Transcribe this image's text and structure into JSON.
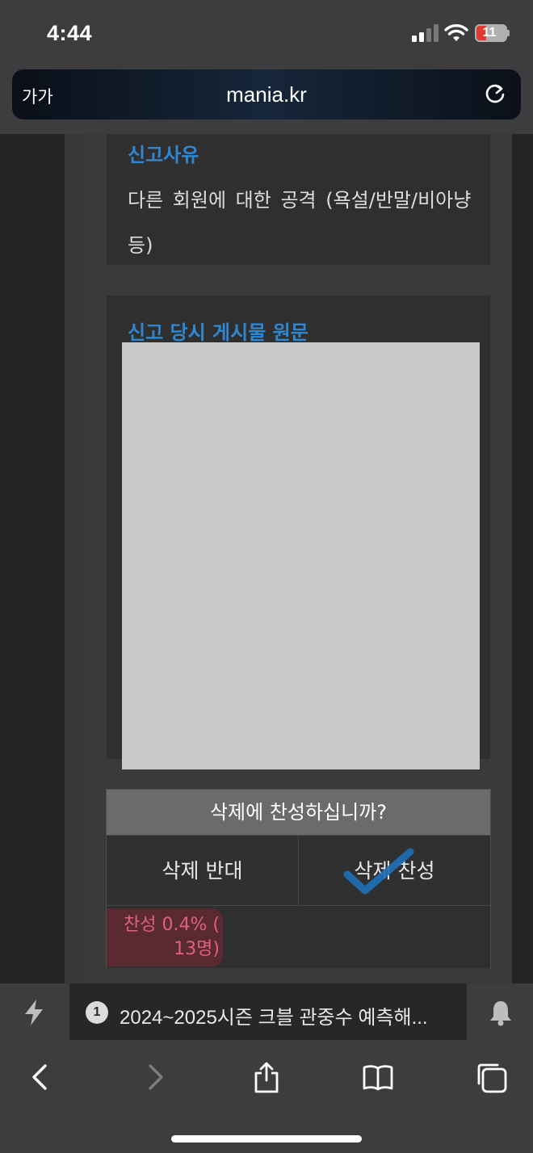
{
  "status_bar": {
    "time": "4:44",
    "battery": "11",
    "icons": [
      "signal-icon",
      "wifi-icon",
      "battery-icon"
    ]
  },
  "address_bar": {
    "text_size_label": "가가",
    "url": "mania.kr",
    "reload_icon": "reload-icon"
  },
  "report": {
    "reason_title": "신고사유",
    "reason_text": "다른 회원에 대한 공격 (욕설/반말/비아냥 등)",
    "original_title": "신고 당시 게시물 원문"
  },
  "vote": {
    "question": "삭제에 찬성하십니까?",
    "oppose_label": "삭제 반대",
    "approve_label": "삭제 찬성",
    "selected": "approve",
    "result_text": "찬성 0.4% ( 13명)",
    "approve_fraction": 0.004
  },
  "notice_bar": {
    "count": "1",
    "text": "2024~2025시즌 크블 관중수 예측해...",
    "icons": [
      "lightning-icon",
      "bell-icon"
    ]
  },
  "toolbar": {
    "icons": [
      "back-icon",
      "forward-icon",
      "share-icon",
      "bookmarks-icon",
      "tabs-icon"
    ]
  },
  "colors": {
    "accent_blue": "#2f86d1",
    "approve_pink": "#e0607c",
    "check_blue": "#1f6fb5"
  }
}
